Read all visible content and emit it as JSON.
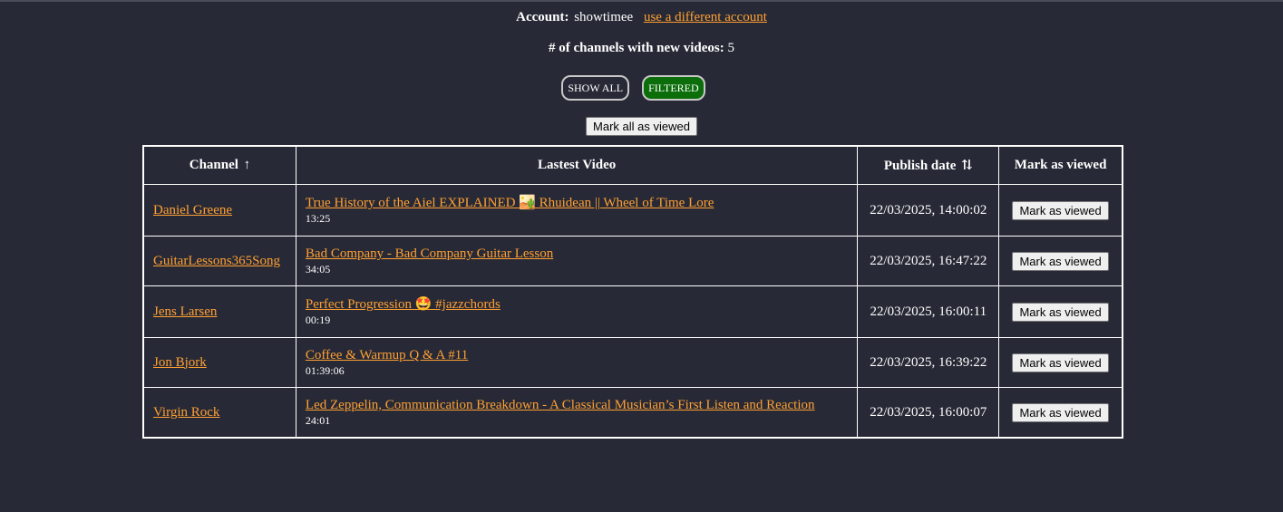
{
  "account": {
    "label": "Account:",
    "username": "showtimee",
    "switch_link": "use a different account"
  },
  "summary": {
    "label": "# of channels with new videos:",
    "count": "5"
  },
  "filters": {
    "show_all": "SHOW ALL",
    "filtered": "FILTERED",
    "active": "filtered",
    "active_color": "#0b6e0b"
  },
  "mark_all_label": "Mark all as viewed",
  "table": {
    "headers": {
      "channel": "Channel",
      "channel_sort_icon": "↑",
      "video": "Lastest Video",
      "date": "Publish date",
      "date_sort_icon": "⇅",
      "mark": "Mark as viewed"
    },
    "rows": [
      {
        "channel": "Daniel Greene",
        "title": "True History of the Aiel EXPLAINED 🏜️ Rhuidean || Wheel of Time Lore",
        "duration": "13:25",
        "date": "22/03/2025, 14:00:02",
        "button": "Mark as viewed"
      },
      {
        "channel": "GuitarLessons365Song",
        "title": "Bad Company - Bad Company Guitar Lesson",
        "duration": "34:05",
        "date": "22/03/2025, 16:47:22",
        "button": "Mark as viewed"
      },
      {
        "channel": "Jens Larsen",
        "title": "Perfect Progression 🤩 #jazzchords",
        "duration": "00:19",
        "date": "22/03/2025, 16:00:11",
        "button": "Mark as viewed"
      },
      {
        "channel": "Jon Bjork",
        "title": "Coffee & Warmup Q & A #11",
        "duration": "01:39:06",
        "date": "22/03/2025, 16:39:22",
        "button": "Mark as viewed"
      },
      {
        "channel": "Virgin Rock",
        "title": "Led Zeppelin, Communication Breakdown - A Classical Musician’s First Listen and Reaction",
        "duration": "24:01",
        "date": "22/03/2025, 16:00:07",
        "button": "Mark as viewed"
      }
    ]
  },
  "colors": {
    "background": "#272a36",
    "link": "#ff9f33",
    "text": "#ffffff"
  }
}
